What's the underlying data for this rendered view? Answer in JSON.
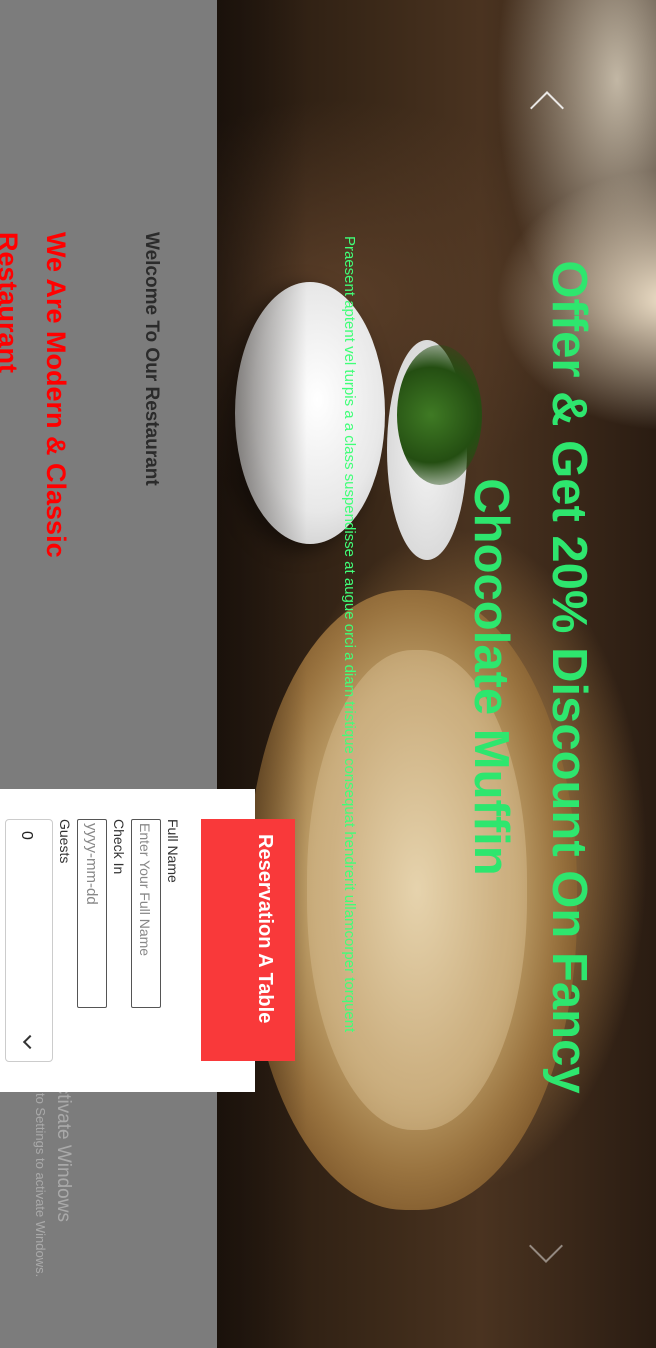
{
  "hero": {
    "headline": "Offer & Get 20% Discount On Fancy Chocolate Muffin",
    "subtext": "Praesent aptent vel turpis a a class suspendisse at augue orci a diam tristique consequat hendrerit ullamcorper torquent",
    "headline_color": "#2ee66e",
    "subtext_color": "#40ff78"
  },
  "side_panel": {
    "welcome": "Welcome To Our Restaurant",
    "tagline": "We Are Modern & Classic Restaurant",
    "tagline_color": "#ff0000",
    "background_color": "#7c7c7c"
  },
  "reservation": {
    "title": "Reservation A Table",
    "banner_color": "#f9393a",
    "fields": {
      "full_name_label": "Full Name",
      "full_name_placeholder": "Enter Your Full Name",
      "check_in_label": "Check In",
      "check_in_placeholder": "yyyy-mm-dd",
      "guests_label": "Guests",
      "guests_value": "0"
    }
  },
  "carousel": {
    "prev_icon": "chevron-up-icon",
    "next_icon": "chevron-down-icon"
  },
  "watermark": {
    "title": "Activate Windows",
    "subtitle": "Go to Settings to activate Windows."
  }
}
